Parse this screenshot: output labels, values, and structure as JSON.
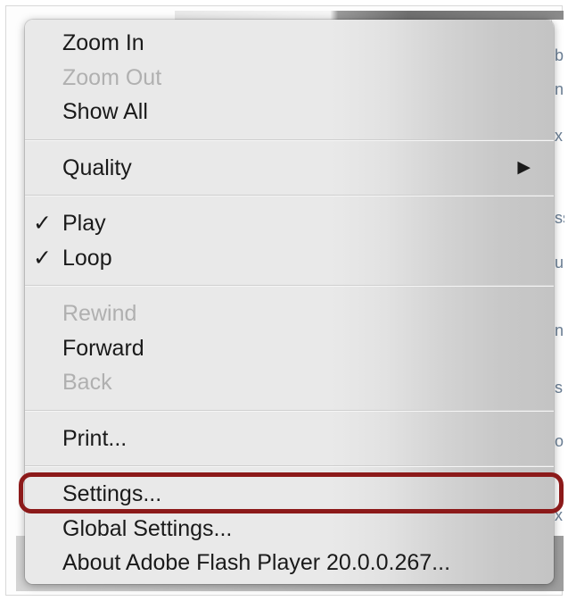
{
  "background": {
    "right_strip_glyphs": [
      "b",
      "n",
      "x",
      "ss",
      "u",
      "nr",
      "s",
      "o",
      "x"
    ]
  },
  "menu": {
    "groups": [
      {
        "items": [
          {
            "label": "Zoom In",
            "enabled": true
          },
          {
            "label": "Zoom Out",
            "enabled": false
          },
          {
            "label": "Show All",
            "enabled": true
          }
        ]
      },
      {
        "items": [
          {
            "label": "Quality",
            "enabled": true,
            "submenu_arrow": "▶"
          }
        ]
      },
      {
        "items": [
          {
            "label": "Play",
            "enabled": true,
            "checked": true,
            "check_glyph": "✓"
          },
          {
            "label": "Loop",
            "enabled": true,
            "checked": true,
            "check_glyph": "✓"
          }
        ]
      },
      {
        "items": [
          {
            "label": "Rewind",
            "enabled": false
          },
          {
            "label": "Forward",
            "enabled": true
          },
          {
            "label": "Back",
            "enabled": false
          }
        ]
      },
      {
        "items": [
          {
            "label": "Print...",
            "enabled": true
          }
        ]
      },
      {
        "items": [
          {
            "label": "Settings...",
            "enabled": true,
            "highlighted": true
          },
          {
            "label": "Global Settings...",
            "enabled": true
          },
          {
            "label": "About Adobe Flash Player 20.0.0.267...",
            "enabled": true
          }
        ]
      }
    ]
  },
  "annotation": {
    "highlight_color": "#8c1a1a"
  }
}
